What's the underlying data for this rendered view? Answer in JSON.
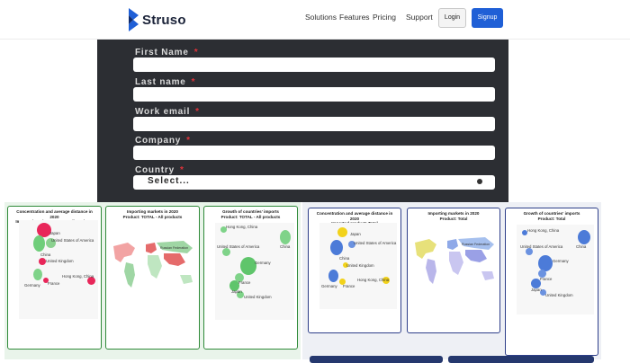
{
  "header": {
    "brand": "Struso",
    "nav": [
      "Solutions",
      "Features",
      "Pricing",
      "Support"
    ],
    "login": "Login",
    "signup": "Signup"
  },
  "form": {
    "fields": [
      {
        "label": "First Name",
        "required": "*"
      },
      {
        "label": "Last name",
        "required": "*"
      },
      {
        "label": "Work email",
        "required": "*"
      },
      {
        "label": "Company",
        "required": "*"
      },
      {
        "label": "Country",
        "required": "*"
      }
    ],
    "country_value": "Select..."
  },
  "dashboards": {
    "green": {
      "card1": {
        "title1": "Concentration and average distance in 2020",
        "title2": "Imported product: TOTAL - All products",
        "labels": [
          "Japan",
          "United States of America",
          "China",
          "United Kingdom",
          "Hong Kong, China",
          "Germany",
          "France"
        ]
      },
      "card2": {
        "title1": "Importing markets in 2020",
        "title2": "Product: TOTAL - All products",
        "map_label": "Russian Federation"
      },
      "card3": {
        "title1": "Growth of countries' imports",
        "title2": "Product: TOTAL - All products",
        "labels": [
          "Hong Kong, China",
          "China",
          "United States of America",
          "Germany",
          "France",
          "Japan",
          "United Kingdom"
        ]
      }
    },
    "blue": {
      "card1": {
        "title1": "Concentration and average distance in 2020",
        "title2": "Imported product: Total",
        "labels": [
          "Japan",
          "United States of America",
          "China",
          "United Kingdom",
          "Hong Kong, China",
          "Germany",
          "France"
        ]
      },
      "card2": {
        "title1": "Importing markets in 2020",
        "title2": "Product: Total",
        "map_label": "Russian Federation"
      },
      "card3": {
        "title1": "Growth of countries' imports",
        "title2": "Product: Total",
        "labels": [
          "Hong Kong, China",
          "China",
          "United States of America",
          "Germany",
          "France",
          "Japan",
          "United Kingdom"
        ]
      }
    }
  },
  "colors": {
    "brand_blue": "#1f5fd6",
    "form_bg": "#2c2e33",
    "required_red": "#e0333a",
    "green_border": "#2f8a39",
    "blue_border": "#2e3f8a"
  }
}
